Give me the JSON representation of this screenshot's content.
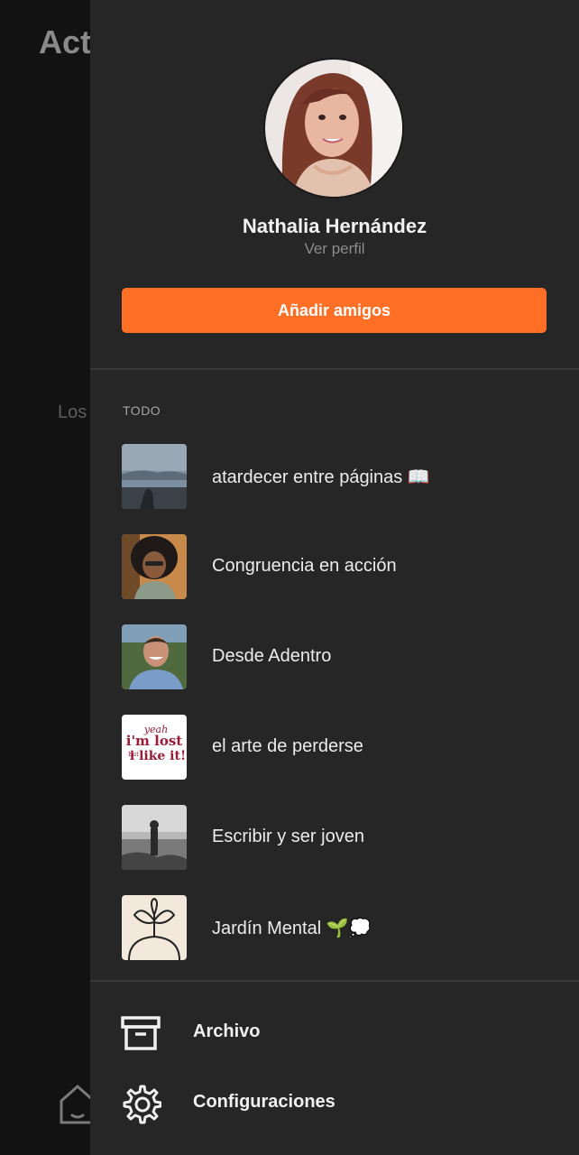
{
  "background": {
    "title": "Act",
    "empty_text": "Los",
    "home_icon": "home-icon"
  },
  "drawer": {
    "profile": {
      "name": "Nathalia Hernández",
      "link": "Ver perfil"
    },
    "add_friends_label": "Añadir amigos",
    "section_label": "TODO",
    "items": [
      {
        "label": "atardecer entre páginas 📖"
      },
      {
        "label": "Congruencia en acción"
      },
      {
        "label": "Desde Adentro"
      },
      {
        "label": "el arte de perderse"
      },
      {
        "label": "Escribir y ser joven"
      },
      {
        "label": "Jardín Mental 🌱💭"
      }
    ],
    "thumb_logo_text": [
      "yeah",
      "i'm lost",
      "but",
      "i like it!"
    ],
    "menu": [
      {
        "label": "Archivo",
        "icon": "archive-icon"
      },
      {
        "label": "Configuraciones",
        "icon": "gear-icon"
      }
    ]
  },
  "colors": {
    "accent": "#ff7026",
    "drawer_bg": "#262626",
    "overlay_bg": "#121212"
  }
}
